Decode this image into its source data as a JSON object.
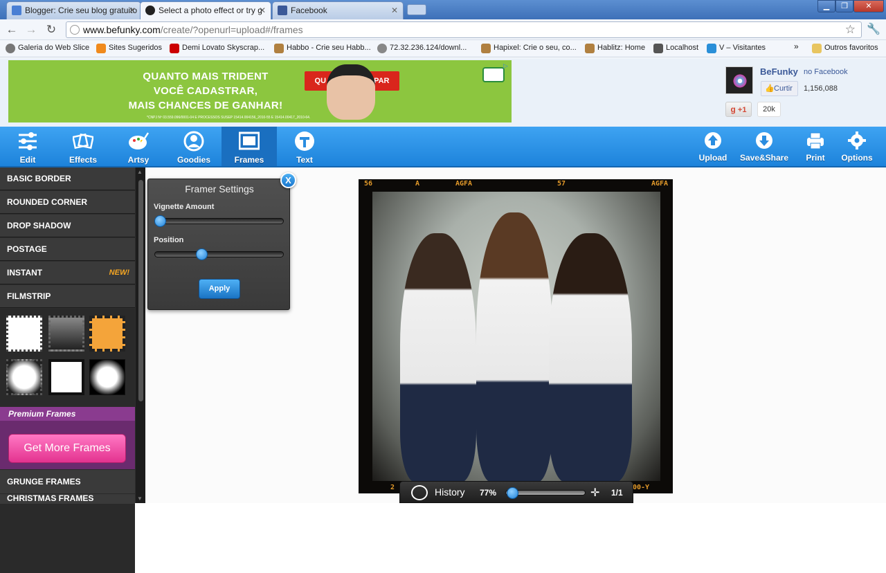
{
  "browser": {
    "tabs": [
      {
        "title": "Blogger: Crie seu blog gratuito",
        "favicon_color": "#4a7fd4"
      },
      {
        "title": "Select a photo effect or try g",
        "favicon_color": "#222222"
      },
      {
        "title": "Facebook",
        "favicon_color": "#3b5998"
      }
    ],
    "close_glyph": "✕",
    "url_domain": "www.befunky.com",
    "url_path": "/create/?openurl=upload#/frames",
    "bookmarks": [
      {
        "label": "Galeria do Web Slice",
        "icon_color": "#777777"
      },
      {
        "label": "Sites Sugeridos",
        "icon_color": "#f08a1c"
      },
      {
        "label": "Demi Lovato Skyscrap...",
        "icon_color": "#cc0000"
      },
      {
        "label": "Habbo - Crie seu Habb...",
        "icon_color": "#b08040"
      },
      {
        "label": "72.32.236.124/downl...",
        "icon_color": "#888888"
      },
      {
        "label": "Hapixel: Crie o seu, co...",
        "icon_color": "#b08040"
      },
      {
        "label": "Hablitz: Home",
        "icon_color": "#b08040"
      },
      {
        "label": "Localhost",
        "icon_color": "#555555"
      },
      {
        "label": "V – Visitantes",
        "icon_color": "#2a8fd8"
      }
    ],
    "more_bookmarks": "»",
    "other_bookmarks": "Outros favoritos"
  },
  "ad": {
    "line1": "QUANTO MAIS TRIDENT",
    "line2": "VOCÊ CADASTRAR,",
    "line3": "MAIS CHANCES DE GANHAR!",
    "button_left": "QU",
    "button_right": "ICIPAR",
    "fine_print": "*CNPJ Nº 03.559.096/0001-04 E PROCESSOS SUSEP 15414.004156_2010-55 E 15414.00417_2010-64."
  },
  "social": {
    "fb_name": "BeFunky",
    "fb_suffix": "no Facebook",
    "like_label": "Curtir",
    "like_count": "1,156,088",
    "gplus_label": "+1",
    "gplus_count": "20k"
  },
  "toolbar": {
    "left": [
      "Edit",
      "Effects",
      "Artsy",
      "Goodies",
      "Frames",
      "Text"
    ],
    "right": [
      "Upload",
      "Save&Share",
      "Print",
      "Options"
    ]
  },
  "sidebar": {
    "categories": [
      "BASIC BORDER",
      "ROUNDED CORNER",
      "DROP SHADOW",
      "POSTAGE",
      "INSTANT",
      "FILMSTRIP"
    ],
    "new_badge": "NEW!",
    "premium_label": "Premium Frames",
    "get_more": "Get More Frames",
    "grunge": "GRUNGE FRAMES",
    "cut_item": "CHRISTMAS FRAMES"
  },
  "framer": {
    "title": "Framer Settings",
    "vignette_label": "Vignette Amount",
    "vignette_value": 0,
    "position_label": "Position",
    "position_value": 0.35,
    "apply": "Apply",
    "close": "X"
  },
  "photo": {
    "film_top": [
      "56",
      "A",
      "AGFA",
      "57",
      "AGFA"
    ],
    "film_bottom": [
      "2",
      "00-Y"
    ]
  },
  "history": {
    "label": "History",
    "zoom": "77%",
    "zoom_value": 0.02,
    "pages": "1/1"
  }
}
